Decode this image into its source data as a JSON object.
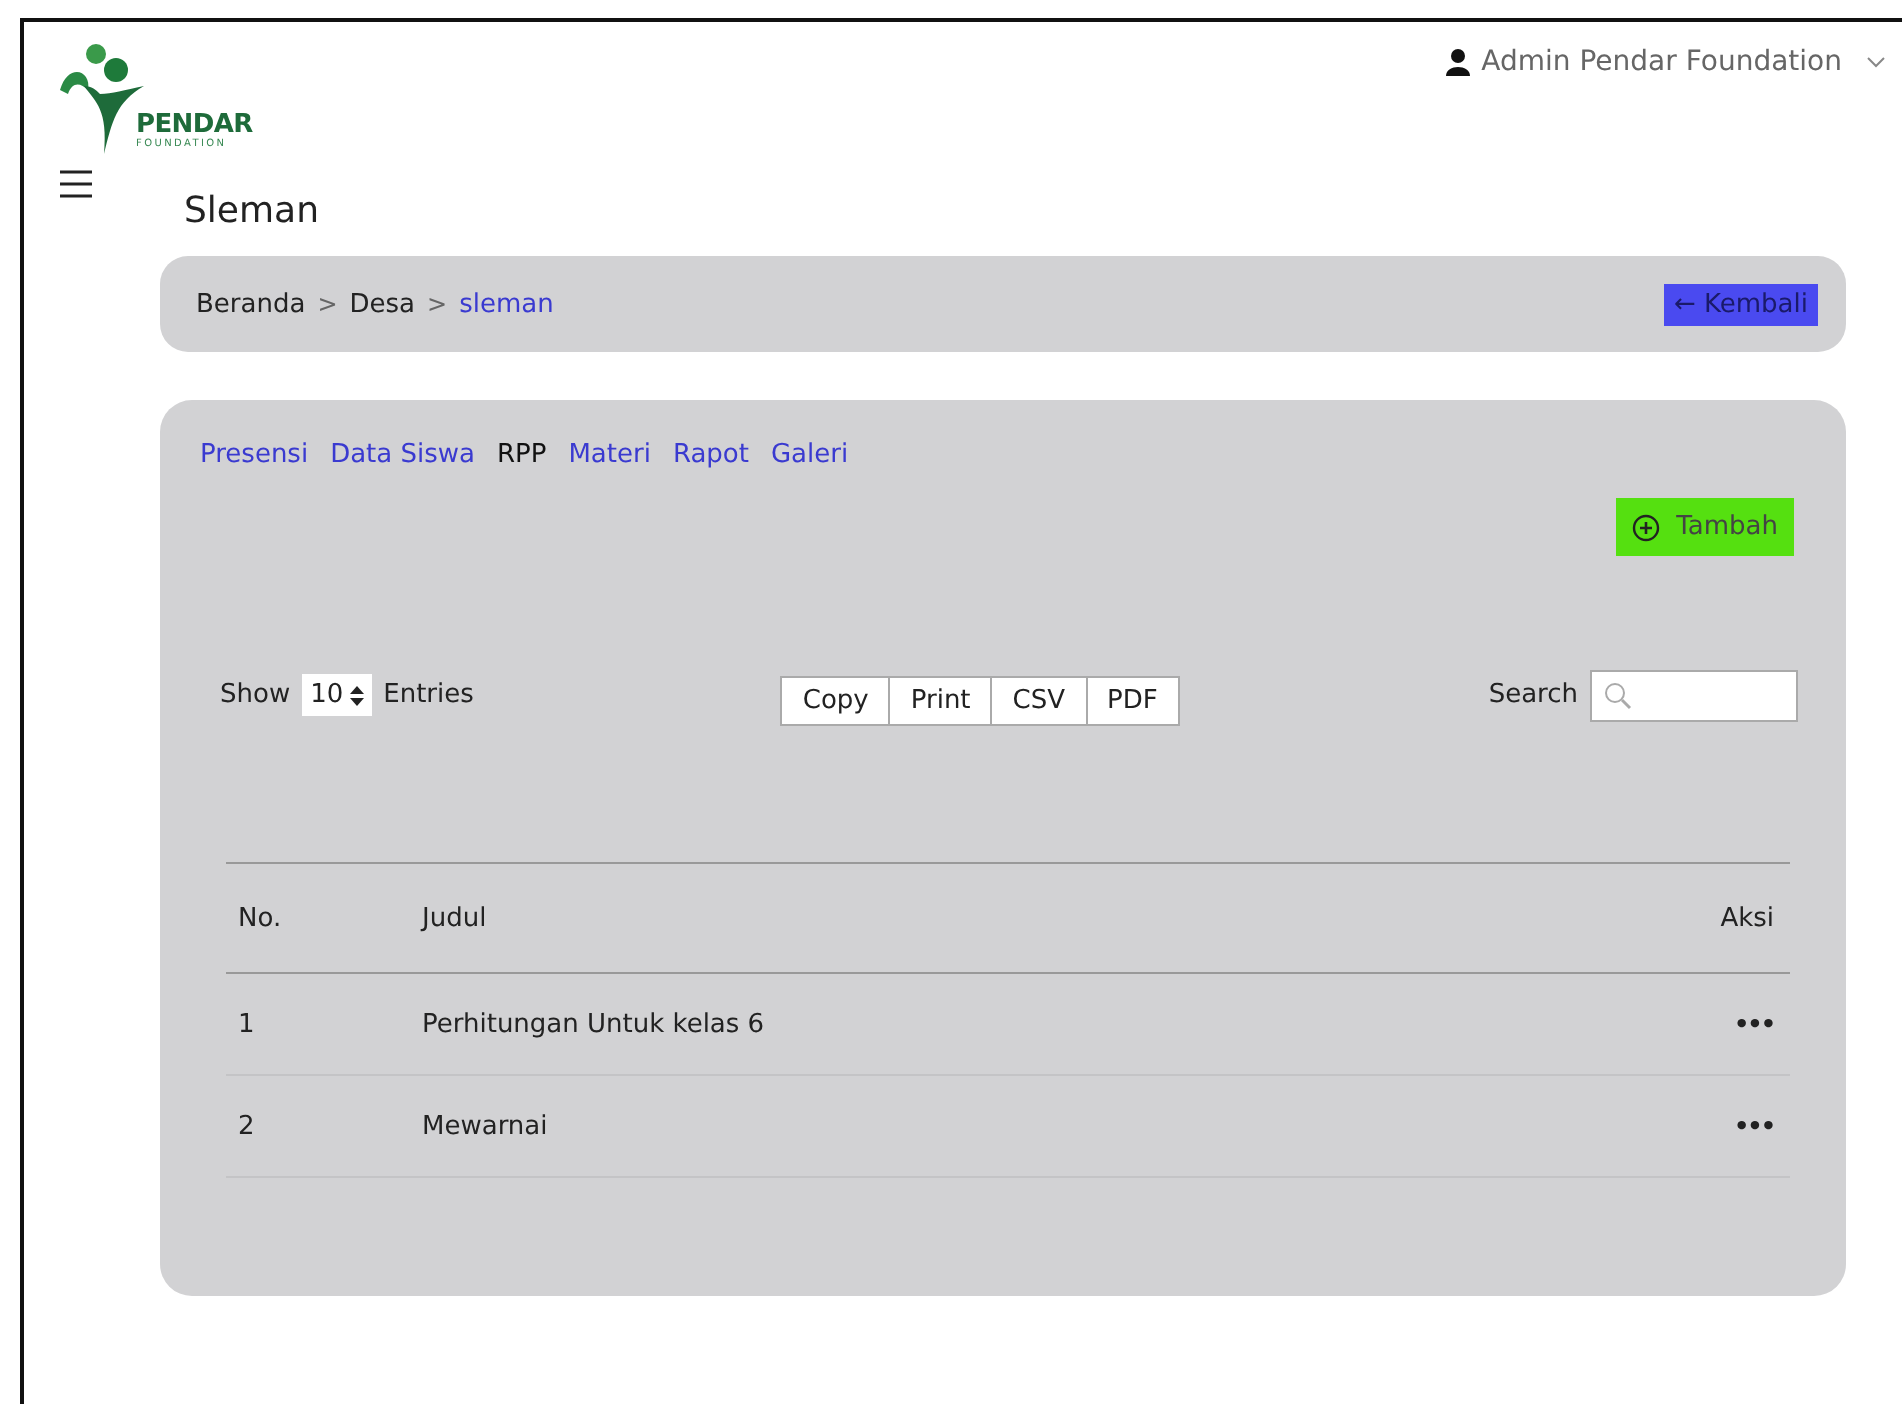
{
  "logo": {
    "name": "PENDAR",
    "subtitle": "FOUNDATION"
  },
  "user_menu": {
    "name": "Admin Pendar Foundation"
  },
  "page_title": "Sleman",
  "breadcrumb": {
    "items": [
      {
        "label": "Beranda",
        "selected": false
      },
      {
        "label": "Desa",
        "selected": false
      },
      {
        "label": "sleman",
        "selected": true
      }
    ],
    "separator": ">"
  },
  "back_button": "← Kembali",
  "tabs": [
    {
      "label": "Presensi",
      "selected": false
    },
    {
      "label": "Data Siswa",
      "selected": false
    },
    {
      "label": "RPP",
      "selected": true
    },
    {
      "label": "Materi",
      "selected": false
    },
    {
      "label": "Rapot",
      "selected": false
    },
    {
      "label": "Galeri",
      "selected": false
    }
  ],
  "add_button": "Tambah",
  "length": {
    "before": "Show",
    "value": "10",
    "after": "Entries"
  },
  "export_buttons": [
    "Copy",
    "Print",
    "CSV",
    "PDF"
  ],
  "search": {
    "label": "Search"
  },
  "table": {
    "columns": [
      "No.",
      "Judul",
      "Aksi"
    ],
    "rows": [
      {
        "no": "1",
        "title": "Perhitungan Untuk kelas 6",
        "action": "•••"
      },
      {
        "no": "2",
        "title": "Mewarnai",
        "action": "•••"
      }
    ]
  }
}
